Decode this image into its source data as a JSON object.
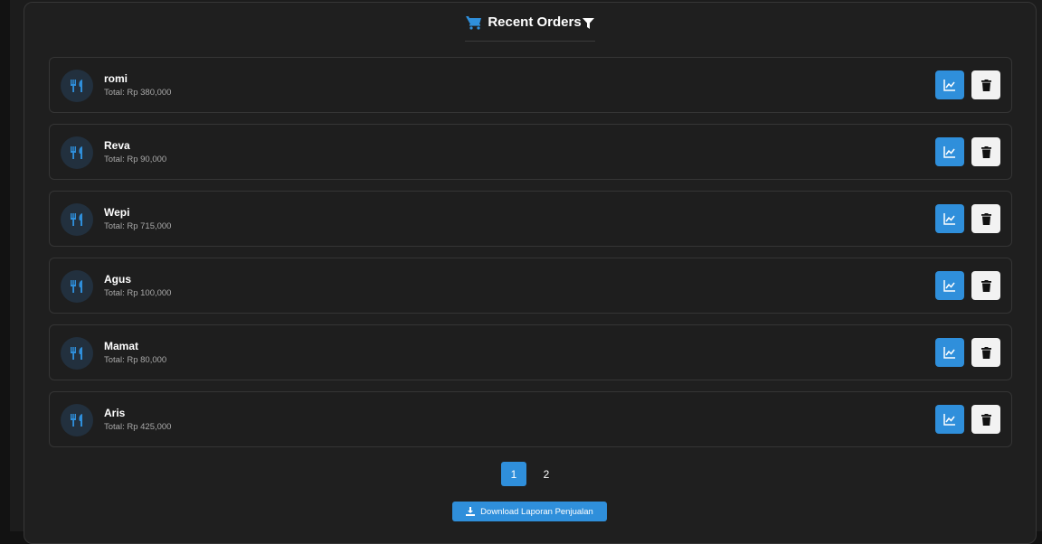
{
  "header": {
    "title": "Recent Orders",
    "icon": "cart-icon",
    "filter_icon": "filter-icon"
  },
  "orders": [
    {
      "name": "romi",
      "total": "Total: Rp 380,000"
    },
    {
      "name": "Reva",
      "total": "Total: Rp 90,000"
    },
    {
      "name": "Wepi",
      "total": "Total: Rp 715,000"
    },
    {
      "name": "Agus",
      "total": "Total: Rp 100,000"
    },
    {
      "name": "Mamat",
      "total": "Total: Rp 80,000"
    },
    {
      "name": "Aris",
      "total": "Total: Rp 425,000"
    }
  ],
  "row_icons": {
    "avatar": "utensils-icon",
    "chart_button": "chart-line-icon",
    "delete_button": "trash-icon"
  },
  "pagination": {
    "pages": [
      "1",
      "2"
    ],
    "current": "1"
  },
  "download_label": "Download Laporan Penjualan",
  "colors": {
    "accent": "#2f8fdb",
    "background": "#1f1f1f",
    "delete_button": "#f2f2f2"
  }
}
